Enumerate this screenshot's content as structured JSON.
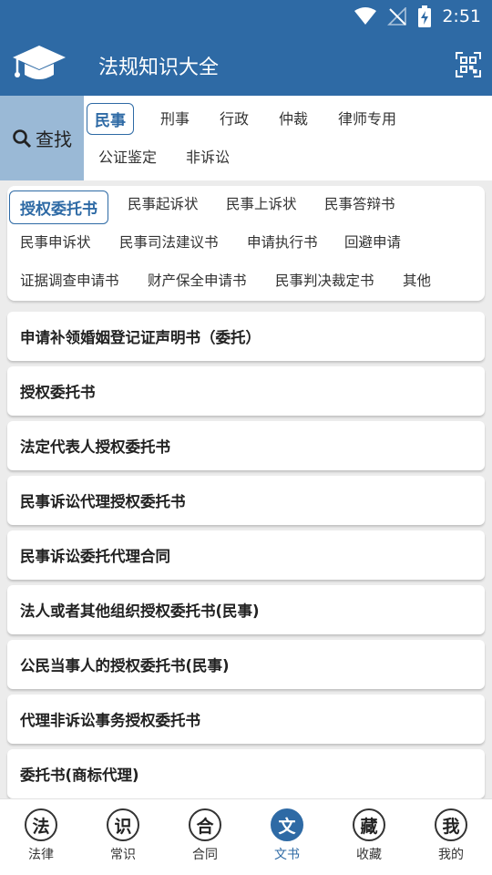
{
  "status_bar": {
    "time": "2:51"
  },
  "app": {
    "title": "法规知识大全"
  },
  "search": {
    "label": "查找"
  },
  "categories": [
    {
      "label": "民事",
      "active": true
    },
    {
      "label": "刑事"
    },
    {
      "label": "行政"
    },
    {
      "label": "仲裁"
    },
    {
      "label": "律师专用"
    },
    {
      "label": "公证鉴定"
    },
    {
      "label": "非诉讼"
    }
  ],
  "subcategories": [
    {
      "label": "授权委托书",
      "active": true
    },
    {
      "label": "民事起诉状"
    },
    {
      "label": "民事上诉状"
    },
    {
      "label": "民事答辩书"
    },
    {
      "label": "民事申诉状"
    },
    {
      "label": "民事司法建议书"
    },
    {
      "label": "申请执行书"
    },
    {
      "label": "回避申请"
    },
    {
      "label": "证据调查申请书"
    },
    {
      "label": "财产保全申请书"
    },
    {
      "label": "民事判决裁定书"
    },
    {
      "label": "其他"
    }
  ],
  "documents": [
    "申请补领婚姻登记证声明书（委托）",
    "授权委托书",
    "法定代表人授权委托书",
    "民事诉讼代理授权委托书",
    "民事诉讼委托代理合同",
    "法人或者其他组织授权委托书(民事)",
    "公民当事人的授权委托书(民事)",
    "代理非诉讼事务授权委托书",
    "委托书(商标代理)"
  ],
  "bottom_nav": [
    {
      "icon_char": "法",
      "label": "法律"
    },
    {
      "icon_char": "识",
      "label": "常识"
    },
    {
      "icon_char": "合",
      "label": "合同"
    },
    {
      "icon_char": "文",
      "label": "文书",
      "active": true
    },
    {
      "icon_char": "藏",
      "label": "收藏"
    },
    {
      "icon_char": "我",
      "label": "我的"
    }
  ],
  "colors": {
    "primary": "#2e6aa5",
    "search_bg": "#9ab9d6",
    "background": "#ececec"
  }
}
